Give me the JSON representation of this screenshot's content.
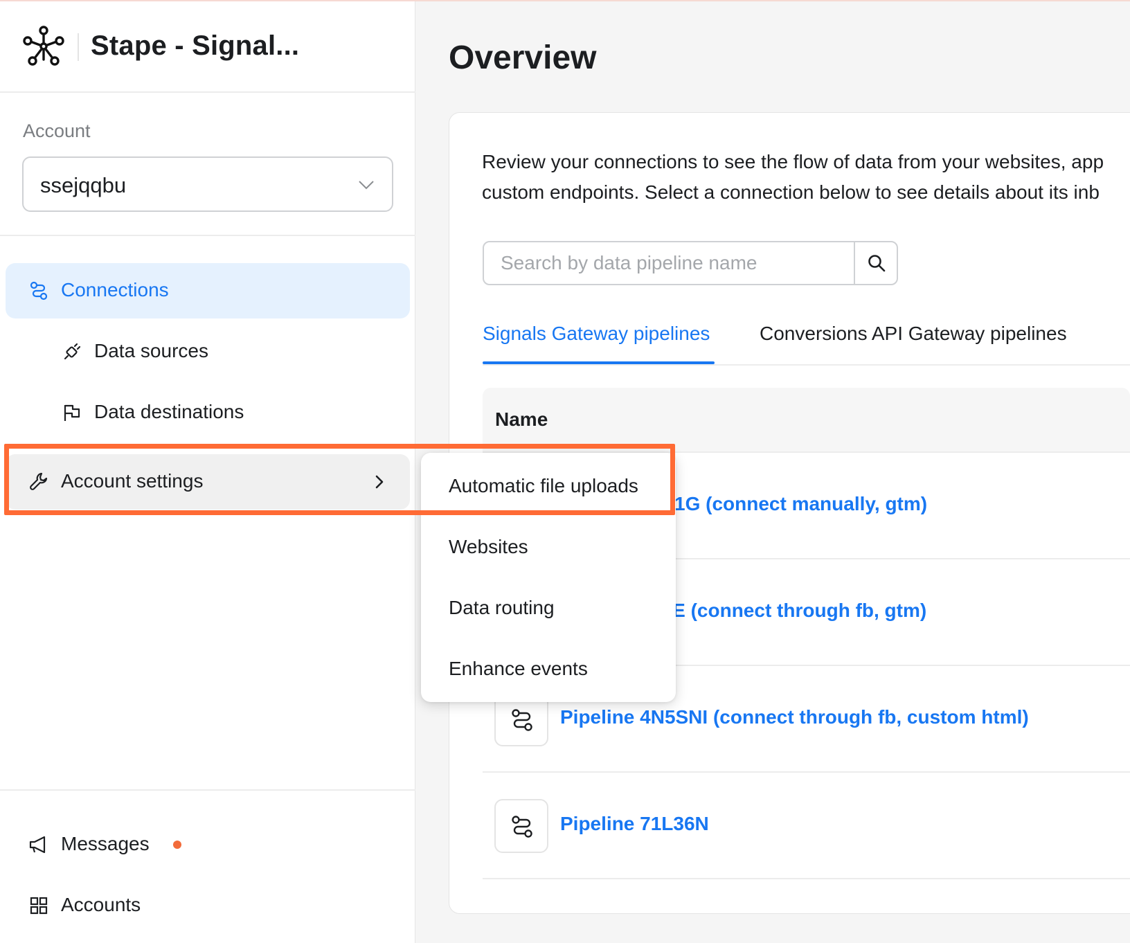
{
  "sidebar": {
    "brand_title": "Stape - Signal...",
    "account_label": "Account",
    "account_value": "ssejqqbu",
    "items": [
      {
        "label": "Connections",
        "icon": "connections-icon",
        "active": true
      },
      {
        "label": "Data sources",
        "icon": "plug-icon"
      },
      {
        "label": "Data destinations",
        "icon": "flag-icon"
      },
      {
        "label": "Account settings",
        "icon": "wrench-icon",
        "has_submenu": true
      }
    ],
    "bottom_items": [
      {
        "label": "Messages",
        "icon": "megaphone-icon",
        "has_unread_dot": true
      },
      {
        "label": "Accounts",
        "icon": "grid-icon"
      }
    ]
  },
  "submenu": {
    "items": [
      "Automatic file uploads",
      "Websites",
      "Data routing",
      "Enhance events"
    ]
  },
  "main": {
    "title": "Overview",
    "description_line1": "Review your connections to see the flow of data from your websites, app",
    "description_line2": "custom endpoints. Select a connection below to see details about its inb",
    "search_placeholder": "Search by data pipeline name",
    "tabs": [
      "Signals Gateway pipelines",
      "Conversions API Gateway pipelines"
    ],
    "table_header": "Name",
    "rows": [
      "CO1G (connect manually, gtm)",
      "8JE (connect through fb, gtm)",
      "Pipeline 4N5SNI (connect through fb, custom html)",
      "Pipeline 71L36N"
    ]
  },
  "colors": {
    "accent": "#1877f2",
    "active_bg": "#e5f1fe",
    "highlight": "#ff6b35",
    "unread_dot": "#f26b3a"
  }
}
